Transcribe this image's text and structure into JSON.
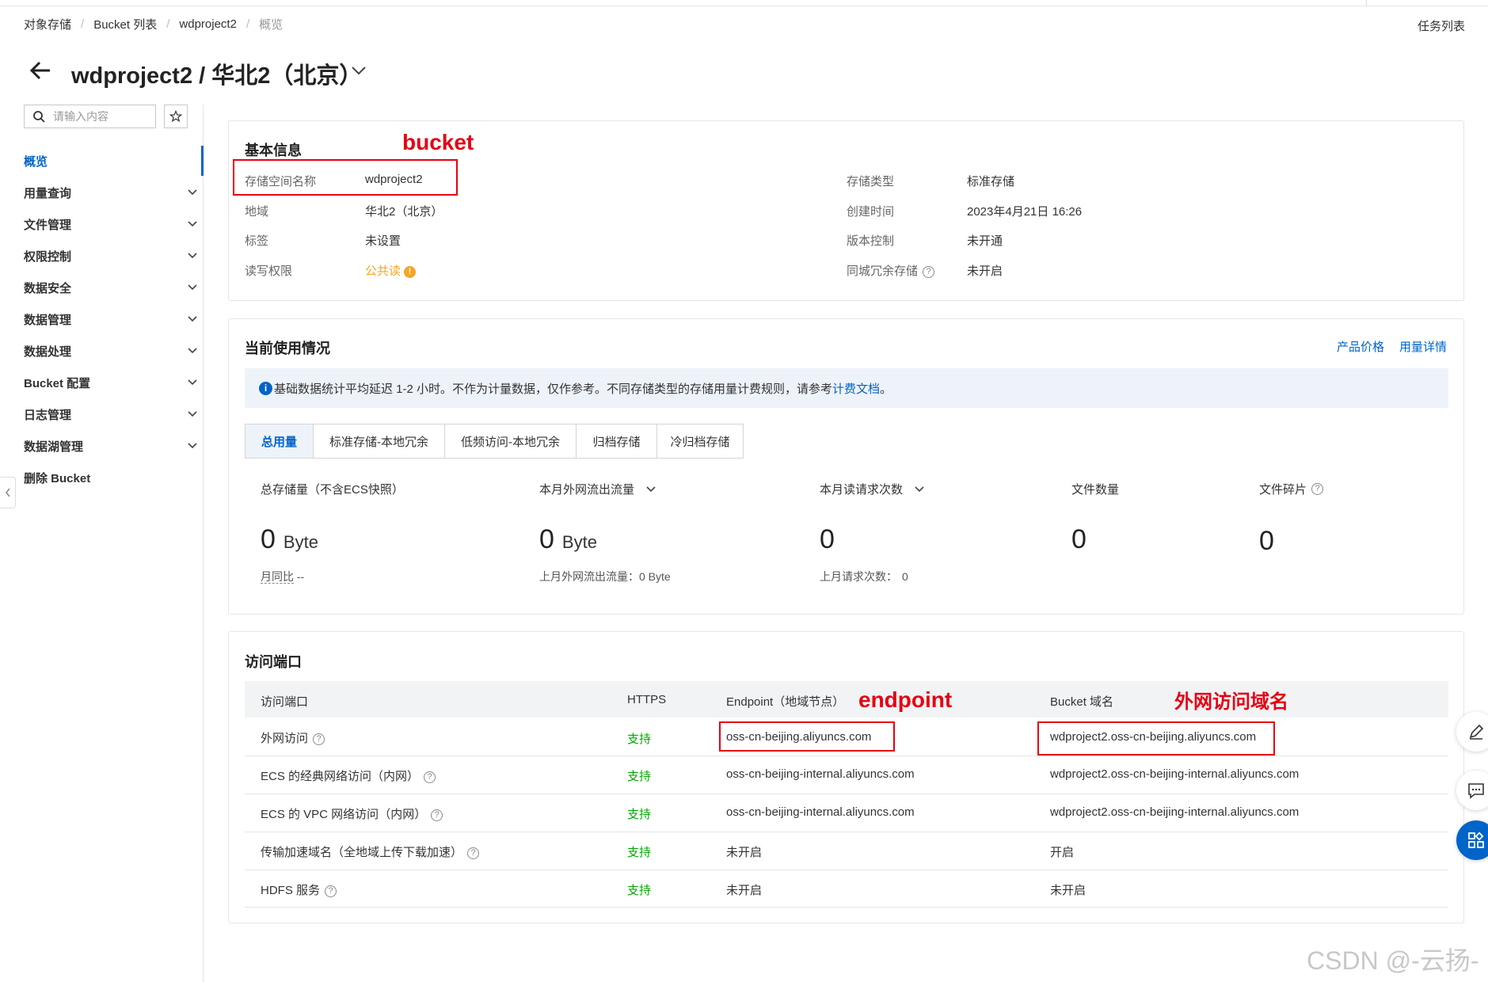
{
  "breadcrumb": [
    "对象存储",
    "Bucket 列表",
    "wdproject2",
    "概览"
  ],
  "task_list": "任务列表",
  "page_title": "wdproject2 / 华北2（北京）",
  "sidebar": {
    "search_placeholder": "请输入内容",
    "items": [
      {
        "label": "概览",
        "active": true
      },
      {
        "label": "用量查询"
      },
      {
        "label": "文件管理"
      },
      {
        "label": "权限控制"
      },
      {
        "label": "数据安全"
      },
      {
        "label": "数据管理"
      },
      {
        "label": "数据处理"
      },
      {
        "label": "Bucket 配置"
      },
      {
        "label": "日志管理"
      },
      {
        "label": "数据湖管理"
      },
      {
        "label": "删除 Bucket"
      }
    ]
  },
  "basic_info": {
    "title": "基本信息",
    "annotation": "bucket",
    "left": [
      {
        "label": "存储空间名称",
        "value": "wdproject2"
      },
      {
        "label": "地域",
        "value": "华北2（北京）"
      },
      {
        "label": "标签",
        "value": "未设置"
      },
      {
        "label": "读写权限",
        "value": "公共读"
      }
    ],
    "right": [
      {
        "label": "存储类型",
        "value": "标准存储"
      },
      {
        "label": "创建时间",
        "value": "2023年4月21日 16:26"
      },
      {
        "label": "版本控制",
        "value": "未开通"
      },
      {
        "label": "同城冗余存储",
        "value": "未开启"
      }
    ]
  },
  "usage": {
    "title": "当前使用情况",
    "links": [
      "产品价格",
      "用量详情"
    ],
    "notice_text": "基础数据统计平均延迟 1-2 小时。不作为计量数据，仅作参考。不同存储类型的存储用量计费规则，请参考",
    "notice_link": "计费文档",
    "notice_end": "。",
    "tabs": [
      "总用量",
      "标准存储-本地冗余",
      "低频访问-本地冗余",
      "归档存储",
      "冷归档存储"
    ],
    "metrics": [
      {
        "label": "总存储量（不含ECS快照）",
        "value": "0",
        "unit": "Byte",
        "sub_label": "月同比",
        "sub_value": "--"
      },
      {
        "label": "本月外网流出流量",
        "value": "0",
        "unit": "Byte",
        "sub_label": "上月外网流出流量：",
        "sub_value": "0 Byte"
      },
      {
        "label": "本月读请求次数",
        "value": "0",
        "unit": "",
        "sub_label": "上月请求次数：",
        "sub_value": "0"
      },
      {
        "label": "文件数量",
        "value": "0"
      },
      {
        "label": "文件碎片",
        "value": "0"
      }
    ]
  },
  "access": {
    "title": "访问端口",
    "annotation_endpoint": "endpoint",
    "annotation_domain": "外网访问域名",
    "headers": [
      "访问端口",
      "HTTPS",
      "Endpoint（地域节点）",
      "Bucket 域名"
    ],
    "rows": [
      {
        "port": "外网访问",
        "https": "支持",
        "endpoint": "oss-cn-beijing.aliyuncs.com",
        "domain": "wdproject2.oss-cn-beijing.aliyuncs.com"
      },
      {
        "port": "ECS 的经典网络访问（内网）",
        "https": "支持",
        "endpoint": "oss-cn-beijing-internal.aliyuncs.com",
        "domain": "wdproject2.oss-cn-beijing-internal.aliyuncs.com"
      },
      {
        "port": "ECS 的 VPC 网络访问（内网）",
        "https": "支持",
        "endpoint": "oss-cn-beijing-internal.aliyuncs.com",
        "domain": "wdproject2.oss-cn-beijing-internal.aliyuncs.com"
      },
      {
        "port": "传输加速域名（全地域上传下载加速）",
        "https": "支持",
        "endpoint": "未开启",
        "domain": "开启"
      },
      {
        "port": "HDFS 服务",
        "https": "支持",
        "endpoint": "未开启",
        "domain": "未开启"
      }
    ]
  },
  "watermark": "CSDN @-云扬-",
  "colors": {
    "accent": "#0064c8",
    "annotation": "#e60012",
    "support": "#00a700",
    "warning": "#f5a623"
  }
}
